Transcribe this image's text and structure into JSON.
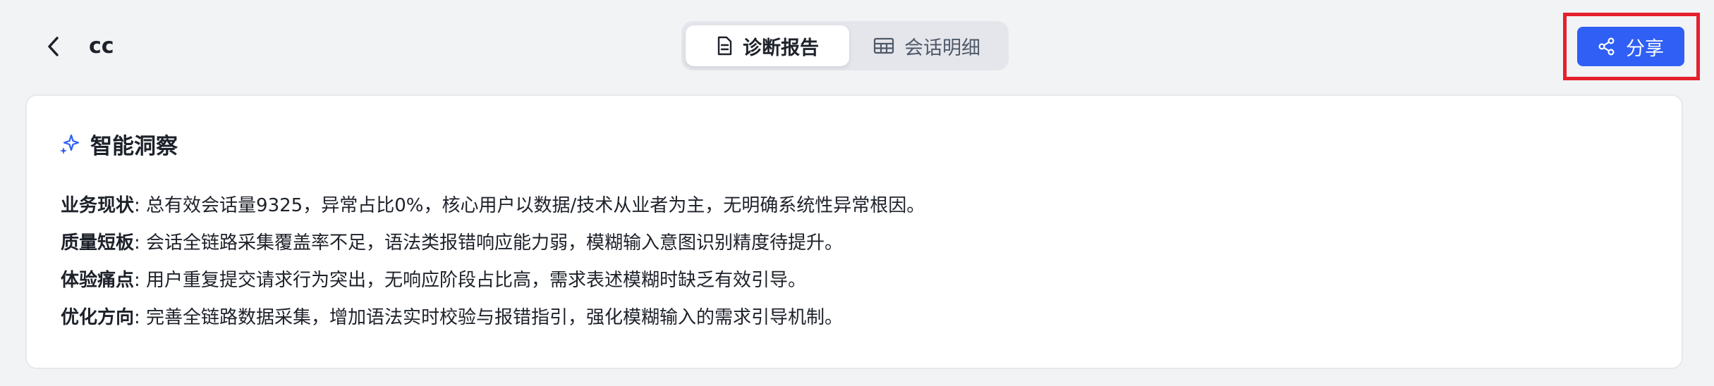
{
  "header": {
    "back_icon": "chevron-left-icon",
    "title": "cc"
  },
  "tabs": [
    {
      "label": "诊断报告",
      "icon": "document-icon",
      "active": true
    },
    {
      "label": "会话明细",
      "icon": "table-icon",
      "active": false
    }
  ],
  "share": {
    "label": "分享",
    "icon": "share-icon",
    "color": "#2f5ff5",
    "highlight_color": "#e5202e"
  },
  "insight": {
    "title": "智能洞察",
    "icon": "sparkle-icon",
    "items": [
      {
        "key": "业务现状",
        "text": ": 总有效会话量9325，异常占比0%，核心用户以数据/技术从业者为主，无明确系统性异常根因。"
      },
      {
        "key": "质量短板",
        "text": ": 会话全链路采集覆盖率不足，语法类报错响应能力弱，模糊输入意图识别精度待提升。"
      },
      {
        "key": "体验痛点",
        "text": ": 用户重复提交请求行为突出，无响应阶段占比高，需求表述模糊时缺乏有效引导。"
      },
      {
        "key": "优化方向",
        "text": ": 完善全链路数据采集，增加语法实时校验与报错指引，强化模糊输入的需求引导机制。"
      }
    ]
  }
}
